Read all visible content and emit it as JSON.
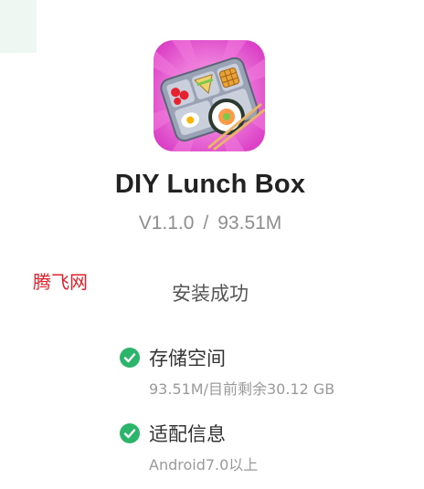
{
  "app": {
    "name": "DIY Lunch Box",
    "version": "V1.1.0",
    "separator": "/",
    "size": "93.51M",
    "icon": "lunch-box-app-icon"
  },
  "watermark": "腾飞网",
  "install_status": "安装成功",
  "checks": [
    {
      "title": "存储空间",
      "detail": "93.51M/目前剩余30.12 GB",
      "icon": "check-circle-icon"
    },
    {
      "title": "适配信息",
      "detail": "Android7.0以上",
      "icon": "check-circle-icon"
    }
  ],
  "colors": {
    "check_green": "#2bb56a",
    "icon_bg": "#e84fd0",
    "watermark_red": "#e0202a"
  }
}
